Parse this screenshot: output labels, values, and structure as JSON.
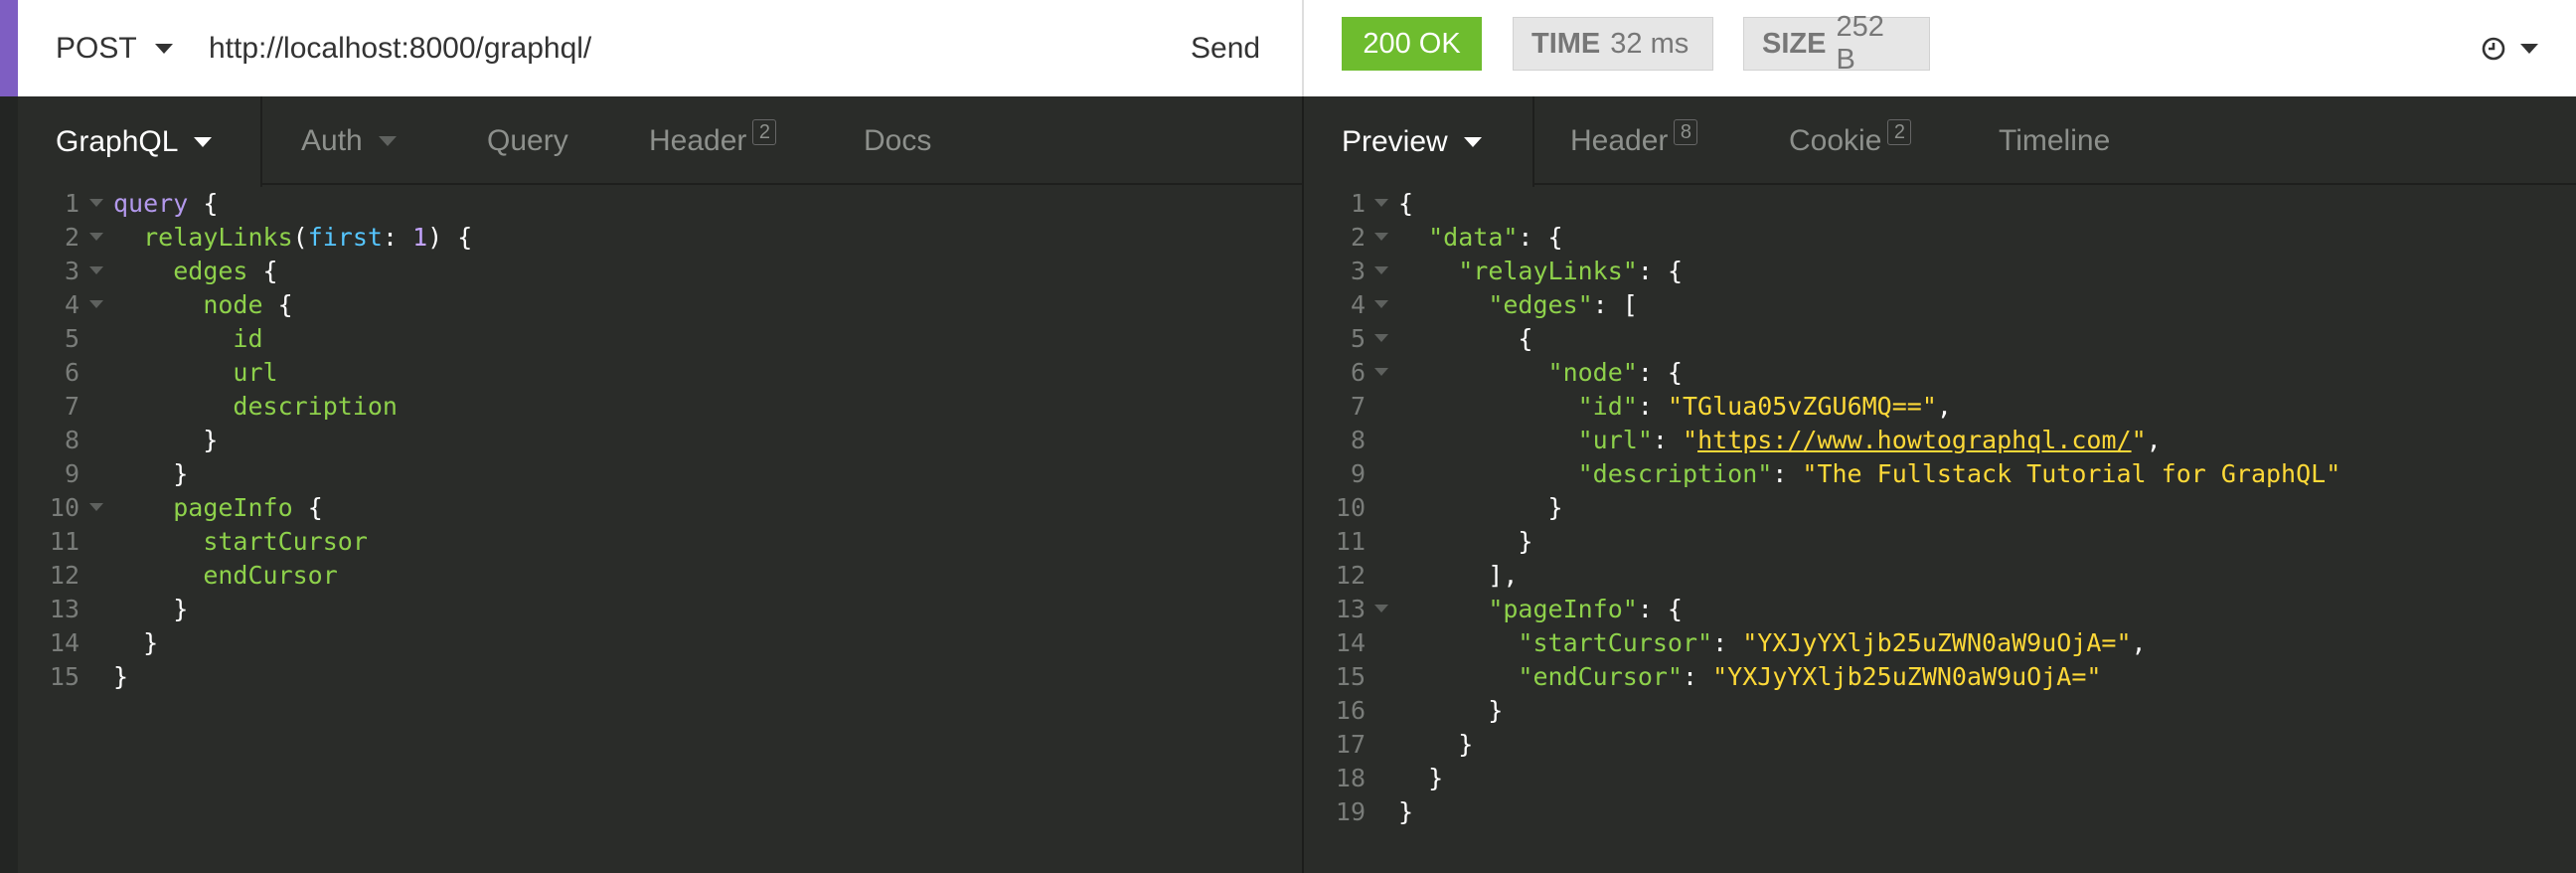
{
  "request": {
    "method": "POST",
    "url": "http://localhost:8000/graphql/",
    "send_label": "Send"
  },
  "response_stats": {
    "status": "200 OK",
    "time_key": "TIME",
    "time_value": "32 ms",
    "size_key": "SIZE",
    "size_value": "252 B"
  },
  "request_tabs": [
    {
      "label": "GraphQL",
      "active": true
    },
    {
      "label": "Auth"
    },
    {
      "label": "Query"
    },
    {
      "label": "Header",
      "count": "2"
    },
    {
      "label": "Docs"
    }
  ],
  "response_tabs": [
    {
      "label": "Preview",
      "active": true
    },
    {
      "label": "Header",
      "count": "8"
    },
    {
      "label": "Cookie",
      "count": "2"
    },
    {
      "label": "Timeline"
    }
  ],
  "query_lines": [
    "query {",
    "  relayLinks(first: 1) {",
    "    edges {",
    "      node {",
    "        id",
    "        url",
    "        description",
    "      }",
    "    }",
    "    pageInfo {",
    "      startCursor",
    "      endCursor",
    "    }",
    "  }",
    "}"
  ],
  "response_lines": [
    "{",
    "  \"data\": {",
    "    \"relayLinks\": {",
    "      \"edges\": [",
    "        {",
    "          \"node\": {",
    "            \"id\": \"TGlua05vZGU6MQ==\",",
    "            \"url\": \"https://www.howtographql.com/\",",
    "            \"description\": \"The Fullstack Tutorial for GraphQL\"",
    "          }",
    "        }",
    "      ],",
    "      \"pageInfo\": {",
    "        \"startCursor\": \"YXJyYXljb25uZWN0aW9uOjA=\",",
    "        \"endCursor\": \"YXJyYXljb25uZWN0aW9uOjA=\"",
    "      }",
    "    }",
    "  }",
    "}"
  ],
  "icons": {
    "method_dropdown": "chevron-down-icon",
    "history": "clock-icon"
  },
  "colors": {
    "accent": "#7e5ec2",
    "status_ok": "#6ebc2e",
    "keyword": "#b399ec",
    "field": "#8ed14b",
    "string": "#fed938",
    "argument": "#56c6ff"
  }
}
